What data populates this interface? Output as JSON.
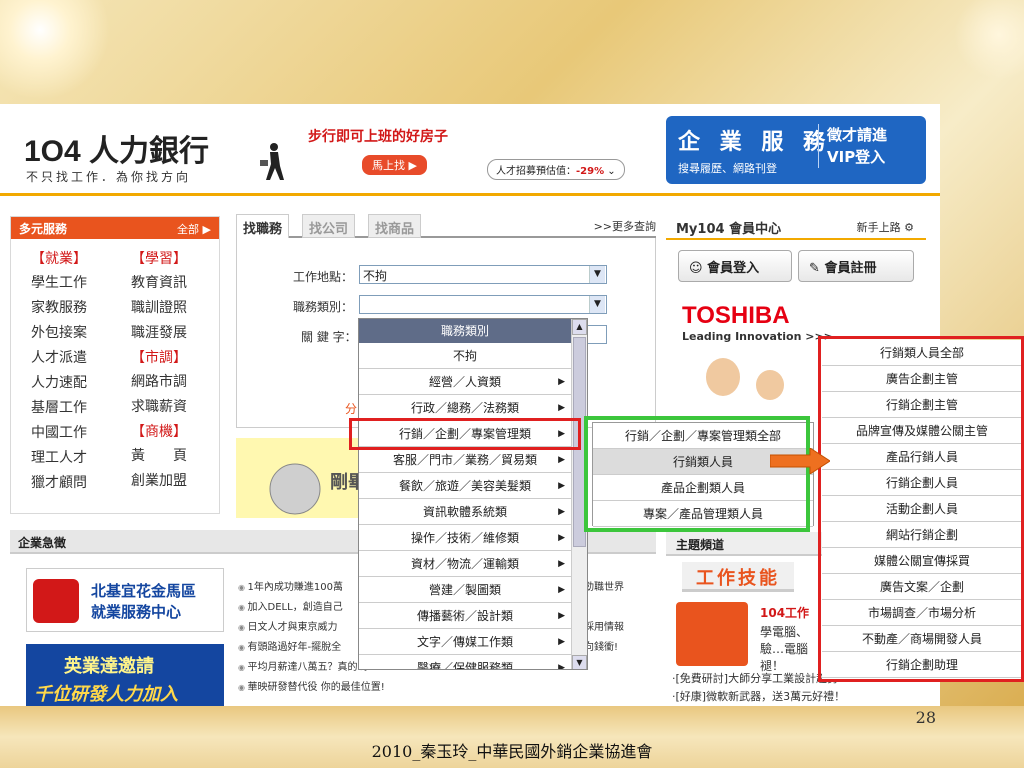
{
  "site": {
    "logo": "1O4 人力銀行",
    "slogan": "不只找工作．為你找方向",
    "promo_title": "步行即可上班的好房子",
    "promo_button": "馬上找",
    "talent_index_label": "人才招募預估值：",
    "talent_index_value": "-29%",
    "enterprise_title": "企 業 服 務",
    "enterprise_sub": "搜尋履歷、網路刊登",
    "enterprise_right_1": "徵才請進",
    "enterprise_right_2": "VIP登入"
  },
  "services": {
    "title": "多元服務",
    "all_label": "全部",
    "col1": [
      {
        "type": "h",
        "text": "【就業】"
      },
      {
        "type": "i",
        "text": "學生工作"
      },
      {
        "type": "i",
        "text": "家教服務"
      },
      {
        "type": "i",
        "text": "外包接案"
      },
      {
        "type": "i",
        "text": "人才派遣"
      },
      {
        "type": "i",
        "text": "人力速配"
      },
      {
        "type": "i",
        "text": "基層工作"
      },
      {
        "type": "i",
        "text": "中國工作"
      },
      {
        "type": "i",
        "text": "理工人才"
      },
      {
        "type": "i",
        "text": "獵才顧問"
      }
    ],
    "col2": [
      {
        "type": "h",
        "text": "【學習】"
      },
      {
        "type": "i",
        "text": "教育資訊"
      },
      {
        "type": "i",
        "text": "職訓證照"
      },
      {
        "type": "i",
        "text": "職涯發展"
      },
      {
        "type": "h",
        "text": "【市調】"
      },
      {
        "type": "i",
        "text": "網路市調"
      },
      {
        "type": "i",
        "text": "求職薪資"
      },
      {
        "type": "h",
        "text": "【商機】"
      },
      {
        "type": "i",
        "text": "黃　　頁"
      },
      {
        "type": "i",
        "text": "創業加盟"
      }
    ]
  },
  "search": {
    "tabs": [
      "找職務",
      "找公司",
      "找商品"
    ],
    "more_query": ">>更多查詢",
    "location_label": "工作地點：",
    "location_value": "不拘",
    "category_label": "職務類別：",
    "category_value": "",
    "keyword_label": "關 鍵 字：",
    "welcome_text": "剛畢",
    "side_char": "分"
  },
  "member": {
    "title": "My104 會員中心",
    "new_user": "新手上路",
    "login_button": "會員登入",
    "register_button": "會員註冊",
    "ad_brand": "TOSHIBA",
    "ad_sub": "Leading Innovation >>>"
  },
  "urgent": {
    "title": "企業急徵",
    "north_title_1": "北基宜花金馬區",
    "north_title_2": "就業服務中心",
    "recruit_1": "英業達邀請",
    "recruit_2": "千位研發人力加入",
    "news": [
      "1年內成功賺進100萬",
      "加入DELL，創造自己",
      "日文人才與東京威力",
      "有頭路過好年-擺脫全",
      "平均月薪達八萬五？真的嗎？",
      "華映研發替代役 你的最佳位置!"
    ],
    "news_right": [
      "勁職世界",
      "",
      "採用情報",
      "向錢衝!"
    ]
  },
  "topic": {
    "title": "主題頻道",
    "banner": "工作技能",
    "skill_title": "104工作",
    "skill_desc": "學電腦、驗…電腦褪！",
    "line1": "‧[免費研討]大師分享工業設計趨勢",
    "line2": "‧[好康]微軟新武器，送3萬元好禮！"
  },
  "job_popup": {
    "title": "職務類別",
    "close": "✕",
    "items": [
      {
        "label": "不拘",
        "arrow": false
      },
      {
        "label": "經營／人資類",
        "arrow": true
      },
      {
        "label": "行政／總務／法務類",
        "arrow": true
      },
      {
        "label": "行銷／企劃／專案管理類",
        "arrow": true
      },
      {
        "label": "客服／門市／業務／貿易類",
        "arrow": true
      },
      {
        "label": "餐飲／旅遊／美容美髮類",
        "arrow": true
      },
      {
        "label": "資訊軟體系統類",
        "arrow": true
      },
      {
        "label": "操作／技術／維修類",
        "arrow": true
      },
      {
        "label": "資材／物流／運輸類",
        "arrow": true
      },
      {
        "label": "營建／製圖類",
        "arrow": true
      },
      {
        "label": "傳播藝術／設計類",
        "arrow": true
      },
      {
        "label": "文字／傳媒工作類",
        "arrow": true
      },
      {
        "label": "醫療／保健服務類",
        "arrow": true
      }
    ]
  },
  "sub_popup": {
    "items": [
      {
        "label": "行銷／企劃／專案管理類全部",
        "selected": false
      },
      {
        "label": "行銷類人員",
        "selected": true
      },
      {
        "label": "產品企劃類人員",
        "selected": false
      },
      {
        "label": "專案／產品管理類人員",
        "selected": false
      }
    ]
  },
  "detail_popup": {
    "items": [
      "行銷類人員全部",
      "廣告企劃主管",
      "行銷企劃主管",
      "品牌宣傳及媒體公關主管",
      "產品行銷人員",
      "行銷企劃人員",
      "活動企劃人員",
      "網站行銷企劃",
      "媒體公關宣傳採買",
      "廣告文案／企劃",
      "市場調查／市場分析",
      "不動產／商場開發人員",
      "行銷企劃助理"
    ]
  },
  "slide": {
    "page_number": "28",
    "footer": "2010_秦玉玲_中華民國外銷企業協進會"
  },
  "colors": {
    "brand_orange": "#e9541e",
    "enterprise_blue": "#1f66c2",
    "annotation_red": "#e02020",
    "annotation_green": "#3cc63c"
  }
}
